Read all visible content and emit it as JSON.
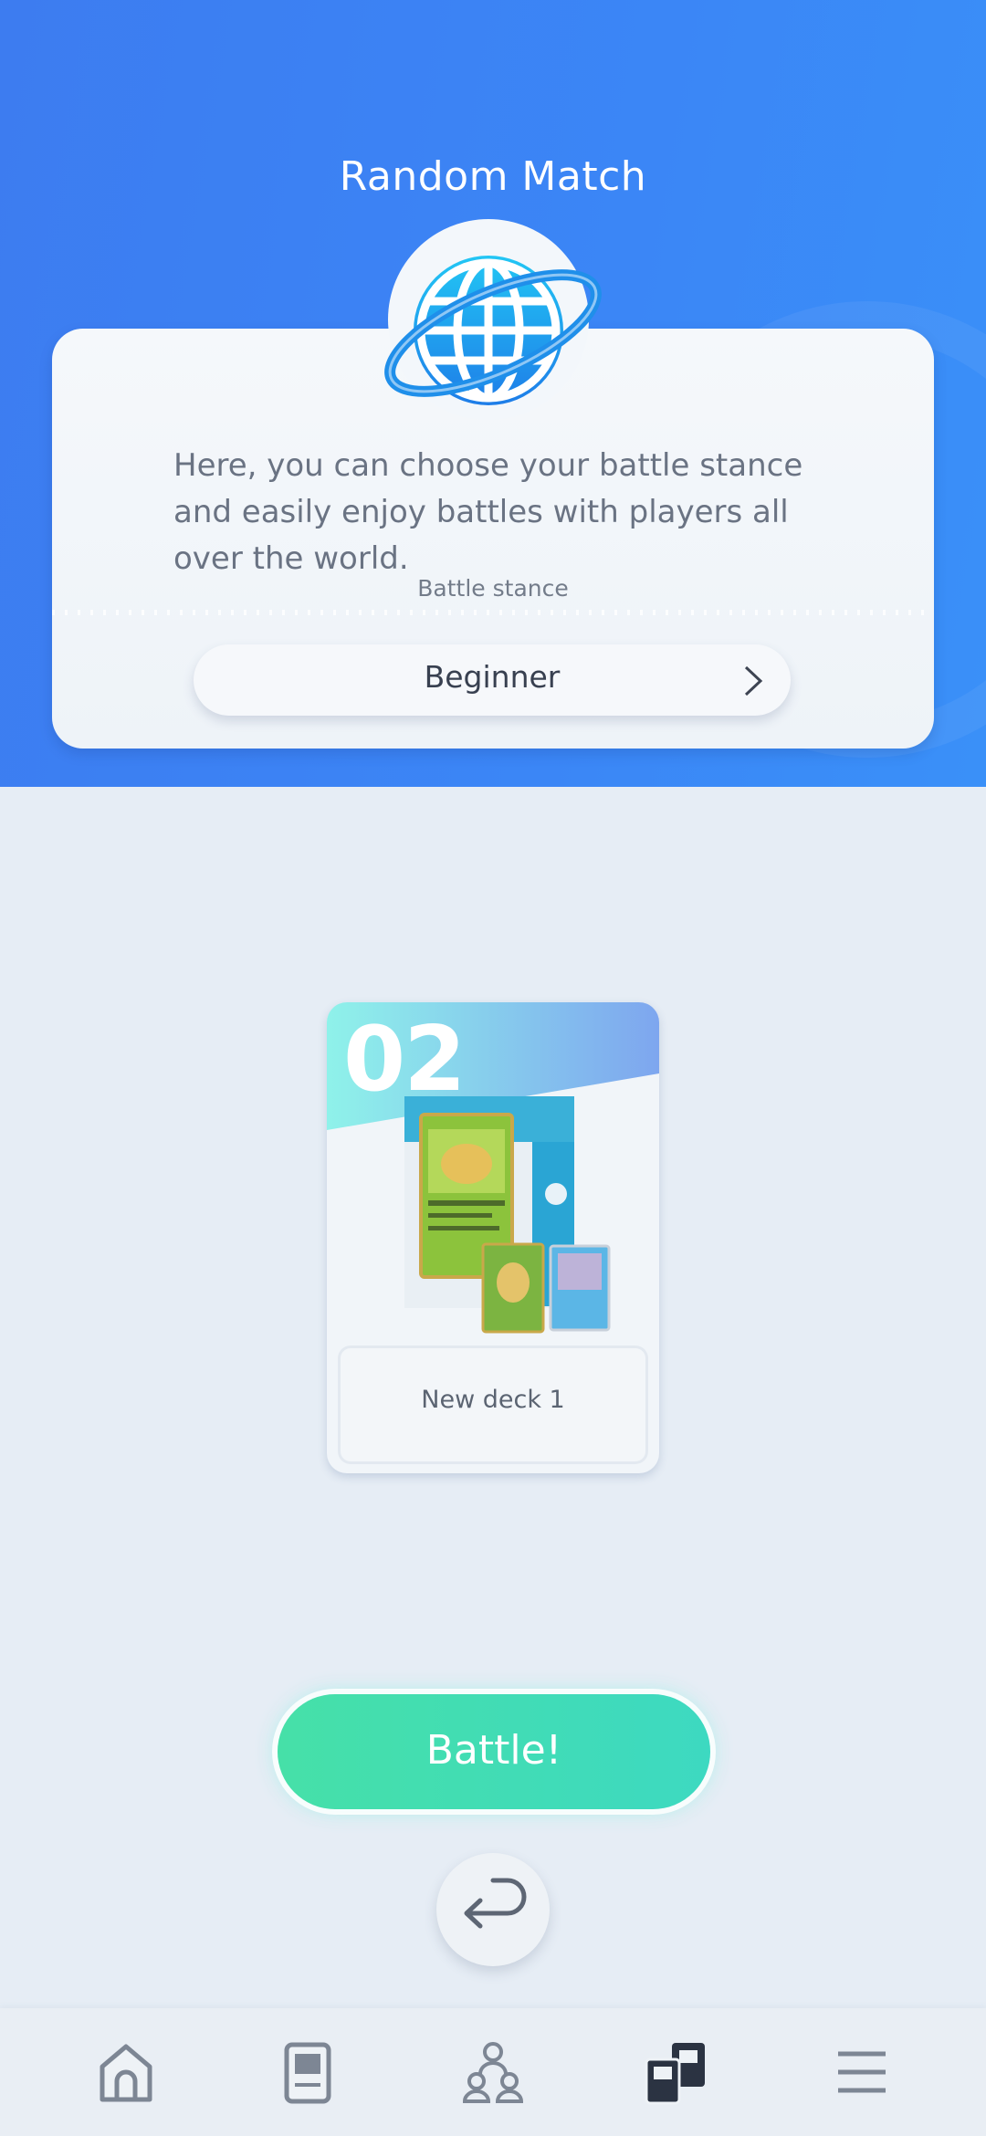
{
  "header": {
    "title": "Random Match"
  },
  "info": {
    "description": "Here, you can choose your battle stance and easily enjoy battles with players all over the world.",
    "stance_label": "Battle stance",
    "stance_value": "Beginner"
  },
  "deck": {
    "number": "02",
    "name": "New deck 1"
  },
  "actions": {
    "battle_label": "Battle!"
  },
  "nav": {
    "items": [
      {
        "name": "home-icon"
      },
      {
        "name": "cards-icon"
      },
      {
        "name": "social-icon"
      },
      {
        "name": "battle-icon",
        "active": true
      },
      {
        "name": "menu-icon"
      }
    ]
  },
  "colors": {
    "header_blue": "#3b86f6",
    "battle_green": "#46e0a8",
    "icon_gray": "#7d8694",
    "icon_dark": "#2b3342"
  }
}
